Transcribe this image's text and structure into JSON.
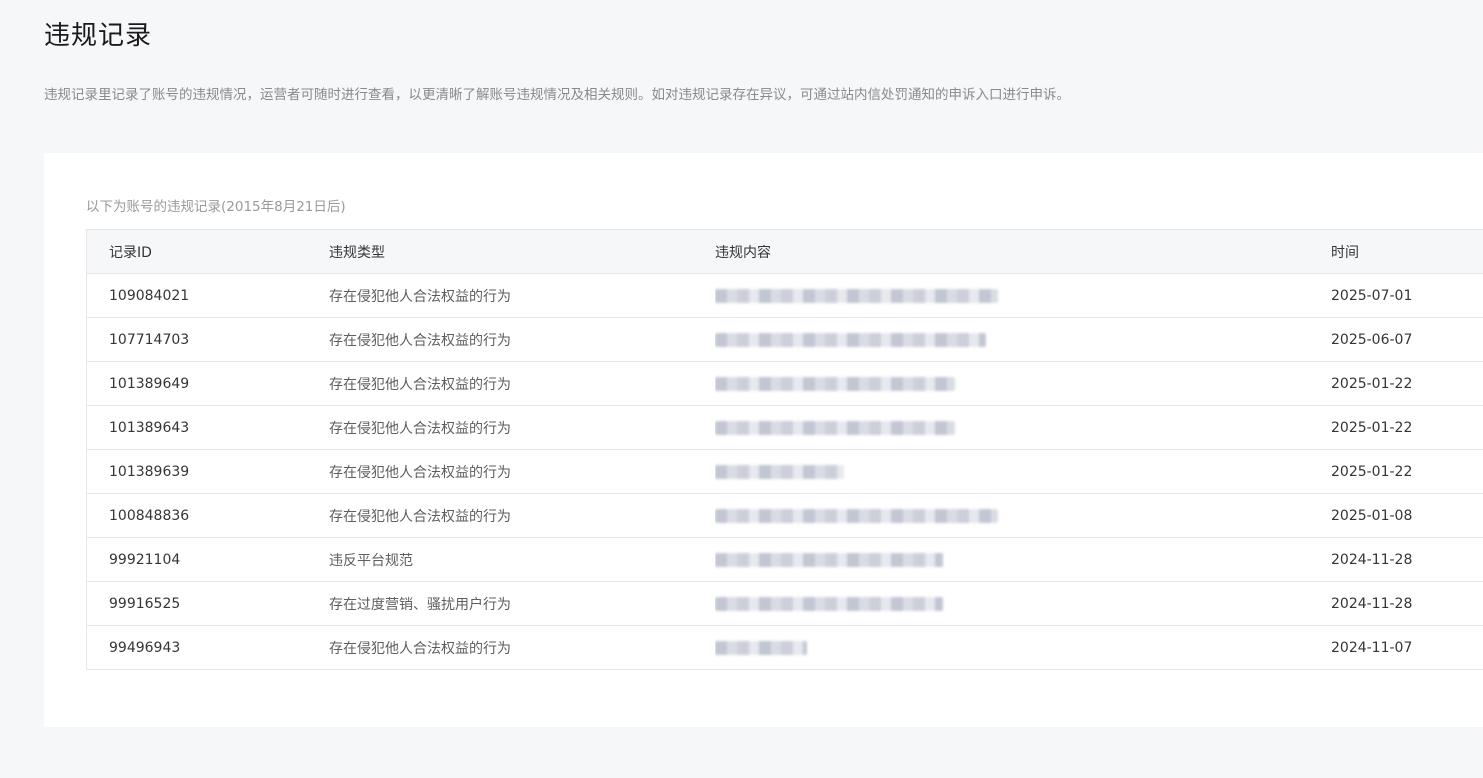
{
  "page": {
    "title": "违规记录",
    "description": "违规记录里记录了账号的违规情况，运营者可随时进行查看，以更清晰了解账号违规情况及相关规则。如对违规记录存在异议，可通过站内信处罚通知的申诉入口进行申诉。"
  },
  "table": {
    "caption": "以下为账号的违规记录(2015年8月21日后)",
    "columns": {
      "id": "记录ID",
      "type": "违规类型",
      "content": "违规内容",
      "time": "时间"
    },
    "rows": [
      {
        "id": "109084021",
        "type": "存在侵犯他人合法权益的行为",
        "content_redacted": 0.46,
        "time": "2025-07-01"
      },
      {
        "id": "107714703",
        "type": "存在侵犯他人合法权益的行为",
        "content_redacted": 0.44,
        "time": "2025-06-07"
      },
      {
        "id": "101389649",
        "type": "存在侵犯他人合法权益的行为",
        "content_redacted": 0.39,
        "time": "2025-01-22"
      },
      {
        "id": "101389643",
        "type": "存在侵犯他人合法权益的行为",
        "content_redacted": 0.39,
        "time": "2025-01-22"
      },
      {
        "id": "101389639",
        "type": "存在侵犯他人合法权益的行为",
        "content_redacted": 0.21,
        "time": "2025-01-22"
      },
      {
        "id": "100848836",
        "type": "存在侵犯他人合法权益的行为",
        "content_redacted": 0.46,
        "time": "2025-01-08"
      },
      {
        "id": "99921104",
        "type": "违反平台规范",
        "content_redacted": 0.37,
        "time": "2024-11-28"
      },
      {
        "id": "99916525",
        "type": "存在过度营销、骚扰用户行为",
        "content_redacted": 0.37,
        "time": "2024-11-28"
      },
      {
        "id": "99496943",
        "type": "存在侵犯他人合法权益的行为",
        "content_redacted": 0.15,
        "time": "2024-11-07"
      }
    ]
  }
}
